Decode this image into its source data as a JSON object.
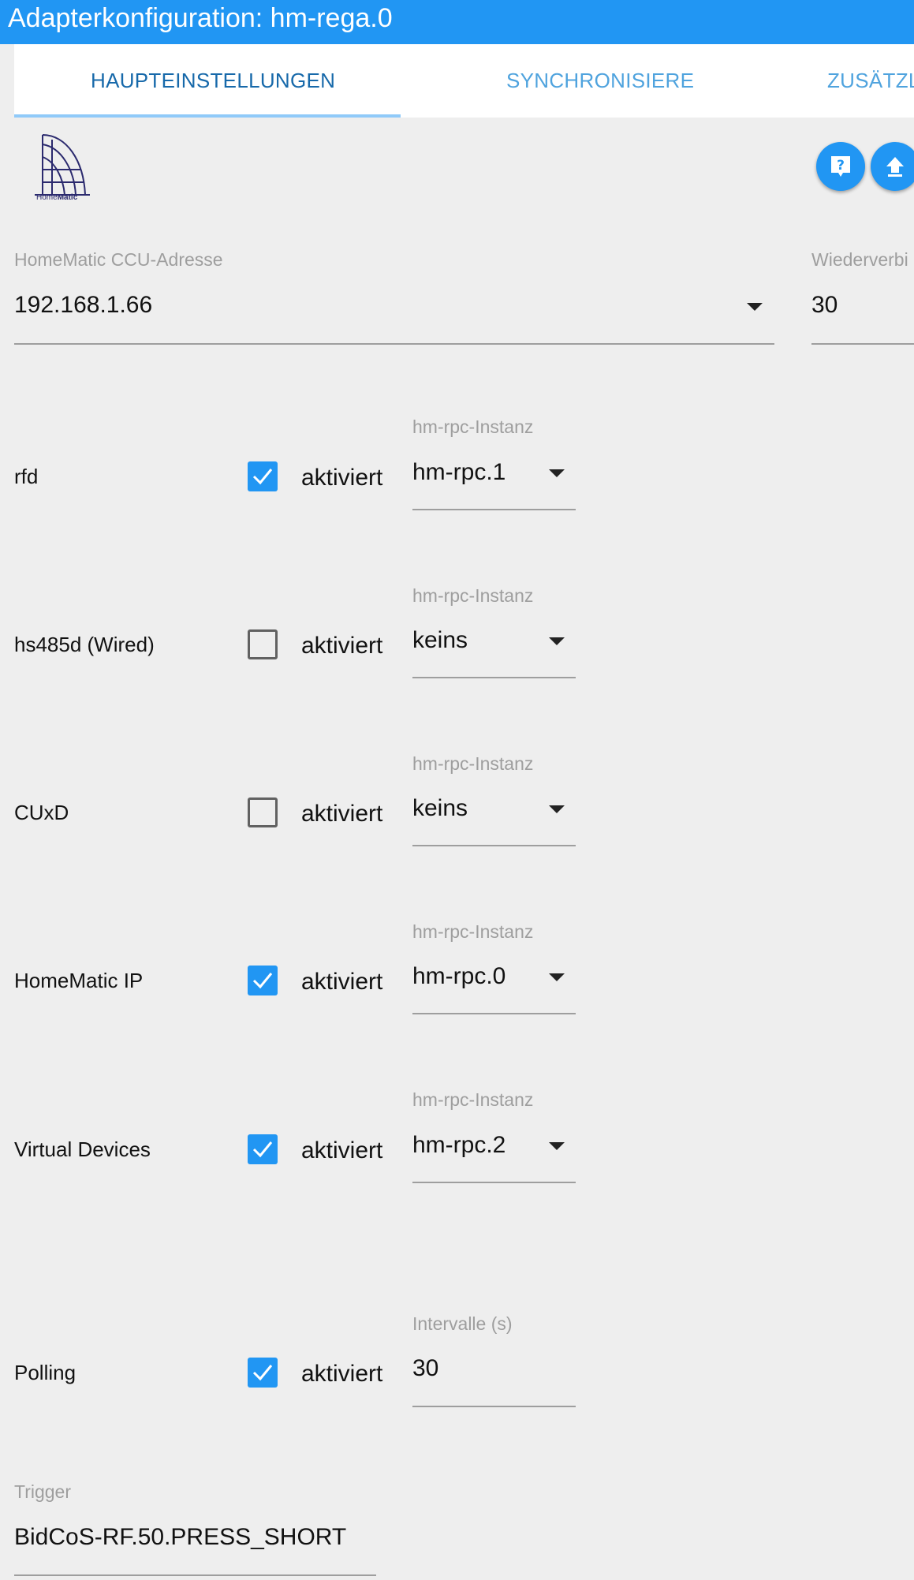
{
  "window": {
    "title": "Adapterkonfiguration: hm-rega.0"
  },
  "tabs": [
    {
      "label": "HAUPTEINSTELLUNGEN",
      "active": true
    },
    {
      "label": "SYNCHRONISIERE",
      "active": false
    },
    {
      "label": "ZUSÄTZL",
      "active": false
    }
  ],
  "logo": {
    "text_home": "Home",
    "text_matic": "Matic"
  },
  "toolbar": {
    "help_icon": "help-icon",
    "upload_icon": "upload-icon"
  },
  "ccu": {
    "label": "HomeMatic CCU-Adresse",
    "value": "192.168.1.66"
  },
  "reconnect": {
    "label": "Wiederverbi",
    "value": "30"
  },
  "interfaces": [
    {
      "name": "rfd",
      "checked": true,
      "check_label": "aktiviert",
      "field_label": "hm-rpc-Instanz",
      "value": "hm-rpc.1"
    },
    {
      "name": "hs485d (Wired)",
      "checked": false,
      "check_label": "aktiviert",
      "field_label": "hm-rpc-Instanz",
      "value": "keins"
    },
    {
      "name": "CUxD",
      "checked": false,
      "check_label": "aktiviert",
      "field_label": "hm-rpc-Instanz",
      "value": "keins"
    },
    {
      "name": "HomeMatic IP",
      "checked": true,
      "check_label": "aktiviert",
      "field_label": "hm-rpc-Instanz",
      "value": "hm-rpc.0"
    },
    {
      "name": "Virtual Devices",
      "checked": true,
      "check_label": "aktiviert",
      "field_label": "hm-rpc-Instanz",
      "value": "hm-rpc.2"
    }
  ],
  "polling": {
    "name": "Polling",
    "checked": true,
    "check_label": "aktiviert",
    "field_label": "Intervalle (s)",
    "value": "30"
  },
  "trigger": {
    "label": "Trigger",
    "value": "BidCoS-RF.50.PRESS_SHORT"
  },
  "colors": {
    "accent": "#2196f3",
    "background": "#eeeeee",
    "tab_active_text": "#1769aa",
    "tab_inactive_text": "#4fa3de"
  }
}
